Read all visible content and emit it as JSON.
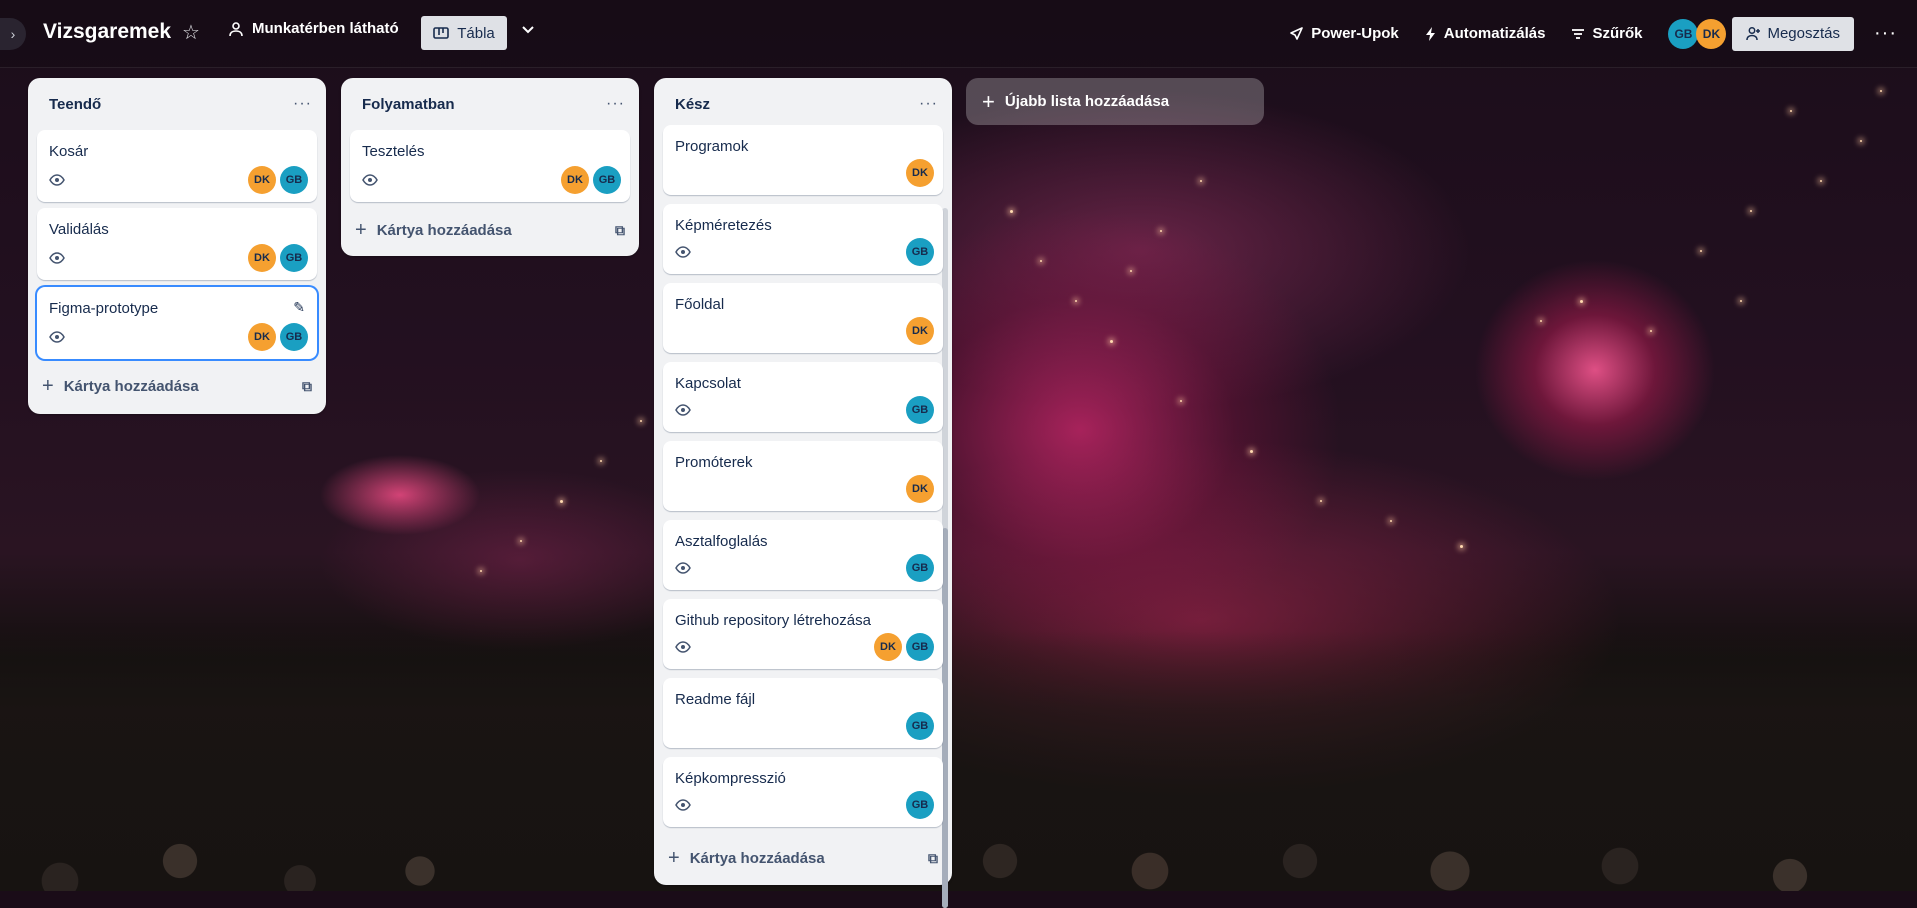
{
  "header": {
    "board_title": "Vizsgaremek",
    "visibility_label": "Munkatérben látható",
    "view_label": "Tábla",
    "power_ups_label": "Power-Upok",
    "automation_label": "Automatizálás",
    "filters_label": "Szűrők",
    "share_label": "Megosztás",
    "members": [
      "GB",
      "DK"
    ]
  },
  "lists": [
    {
      "title": "Teendő",
      "add_card_label": "Kártya hozzáadása",
      "cards": [
        {
          "title": "Kosár",
          "members": [
            "DK",
            "GB"
          ],
          "watch": true
        },
        {
          "title": "Validálás",
          "members": [
            "DK",
            "GB"
          ],
          "watch": true
        },
        {
          "title": "Figma-prototype",
          "members": [
            "DK",
            "GB"
          ],
          "watch": true,
          "selected": true
        }
      ]
    },
    {
      "title": "Folyamatban",
      "add_card_label": "Kártya hozzáadása",
      "cards": [
        {
          "title": "Tesztelés",
          "members": [
            "DK",
            "GB"
          ],
          "watch": true
        }
      ]
    },
    {
      "title": "Kész",
      "add_card_label": "Kártya hozzáadása",
      "cards": [
        {
          "title": "Programok",
          "members": [
            "DK"
          ],
          "watch": false
        },
        {
          "title": "Képméretezés",
          "members": [
            "GB"
          ],
          "watch": true
        },
        {
          "title": "Főoldal",
          "members": [
            "DK"
          ],
          "watch": false
        },
        {
          "title": "Kapcsolat",
          "members": [
            "GB"
          ],
          "watch": true
        },
        {
          "title": "Promóterek",
          "members": [
            "DK"
          ],
          "watch": false
        },
        {
          "title": "Asztalfoglalás",
          "members": [
            "GB"
          ],
          "watch": true
        },
        {
          "title": "Github repository létrehozása",
          "members": [
            "DK",
            "GB"
          ],
          "watch": true
        },
        {
          "title": "Readme fájl",
          "members": [
            "GB"
          ],
          "watch": false
        },
        {
          "title": "Képkompresszió",
          "members": [
            "GB"
          ],
          "watch": true
        }
      ]
    }
  ],
  "add_list_label": "Újabb lista hozzáadása",
  "colors": {
    "dk_avatar": "#f5a030",
    "gb_avatar": "#1a9fc2",
    "selected_outline": "#388bff"
  },
  "icons": [
    "chevron-right-icon",
    "star-icon",
    "people-icon",
    "board-icon",
    "chevron-down-icon",
    "rocket-icon",
    "lightning-icon",
    "filter-icon",
    "add-person-icon",
    "more-icon",
    "eye-icon",
    "plus-icon",
    "template-icon",
    "pencil-icon"
  ]
}
